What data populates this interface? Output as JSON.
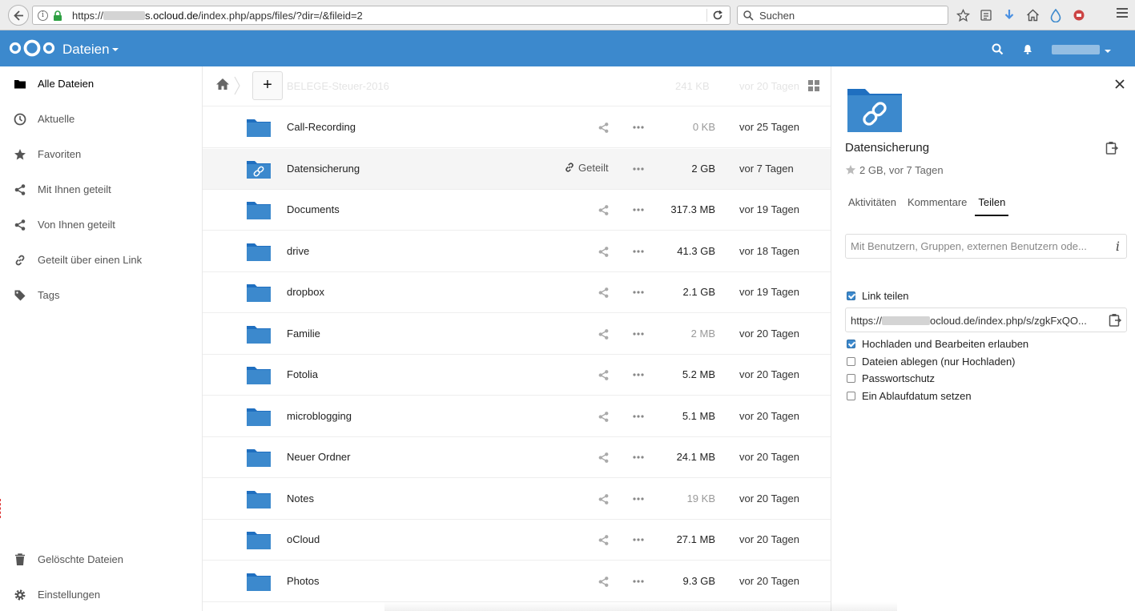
{
  "browser": {
    "url_prefix": "https://",
    "url_host": "s.ocloud.de",
    "url_path": "/index.php/apps/files/?dir=/&fileid=2",
    "search_placeholder": "Suchen"
  },
  "header": {
    "app_name": "Dateien",
    "accent_color": "#3c89cd"
  },
  "sidebar": {
    "items": [
      {
        "label": "Alle Dateien",
        "icon": "folder-icon",
        "active": true
      },
      {
        "label": "Aktuelle",
        "icon": "clock-icon"
      },
      {
        "label": "Favoriten",
        "icon": "star-icon"
      },
      {
        "label": "Mit Ihnen geteilt",
        "icon": "share-icon"
      },
      {
        "label": "Von Ihnen geteilt",
        "icon": "share-icon"
      },
      {
        "label": "Geteilt über einen Link",
        "icon": "link-icon"
      },
      {
        "label": "Tags",
        "icon": "tag-icon"
      }
    ],
    "bottom_items": [
      {
        "label": "Gelöschte Dateien",
        "icon": "trash-icon"
      },
      {
        "label": "Einstellungen",
        "icon": "gear-icon"
      }
    ]
  },
  "files": {
    "ghost_row": {
      "name": "BELEGE-Steuer-2016",
      "size": "241 KB",
      "date": "vor 20 Tagen"
    },
    "rows": [
      {
        "name": "Call-Recording",
        "size": "0 KB",
        "date": "vor 25 Tagen"
      },
      {
        "name": "Datensicherung",
        "size": "2 GB",
        "date": "vor 7 Tagen",
        "shared": "Geteilt"
      },
      {
        "name": "Documents",
        "size": "317.3 MB",
        "date": "vor 19 Tagen"
      },
      {
        "name": "drive",
        "size": "41.3 GB",
        "date": "vor 18 Tagen"
      },
      {
        "name": "dropbox",
        "size": "2.1 GB",
        "date": "vor 19 Tagen"
      },
      {
        "name": "Familie",
        "size": "2 MB",
        "date": "vor 20 Tagen"
      },
      {
        "name": "Fotolia",
        "size": "5.2 MB",
        "date": "vor 20 Tagen"
      },
      {
        "name": "microblogging",
        "size": "5.1 MB",
        "date": "vor 20 Tagen"
      },
      {
        "name": "Neuer Ordner",
        "size": "24.1 MB",
        "date": "vor 20 Tagen"
      },
      {
        "name": "Notes",
        "size": "19 KB",
        "date": "vor 20 Tagen"
      },
      {
        "name": "oCloud",
        "size": "27.1 MB",
        "date": "vor 20 Tagen"
      },
      {
        "name": "Photos",
        "size": "9.3 GB",
        "date": "vor 20 Tagen"
      }
    ]
  },
  "details": {
    "title": "Datensicherung",
    "meta": "2 GB, vor 7 Tagen",
    "tabs": [
      "Aktivitäten",
      "Kommentare",
      "Teilen"
    ],
    "active_tab": "Teilen",
    "share_placeholder": "Mit Benutzern, Gruppen, externen Benutzern ode...",
    "link_share_label": "Link teilen",
    "link_prefix": "https://",
    "link_suffix": "ocloud.de/index.php/s/zgkFxQO...",
    "options": [
      {
        "label": "Hochladen und Bearbeiten erlauben",
        "checked": true
      },
      {
        "label": "Dateien ablegen (nur Hochladen)",
        "checked": false
      },
      {
        "label": "Passwortschutz",
        "checked": false
      },
      {
        "label": "Ein Ablaufdatum setzen",
        "checked": false
      }
    ]
  }
}
